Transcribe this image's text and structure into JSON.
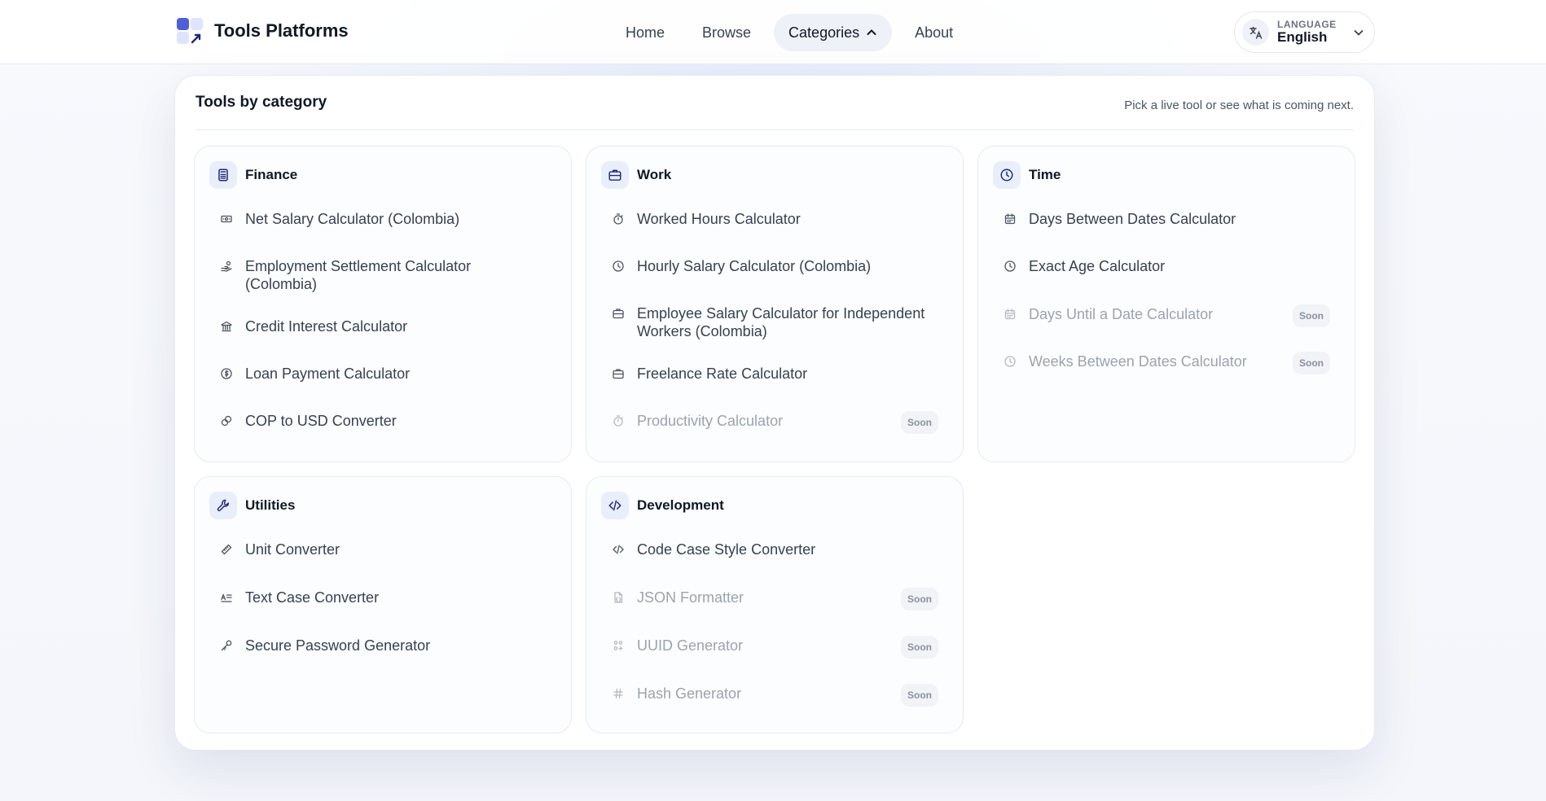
{
  "brand": {
    "name": "Tools Platforms"
  },
  "nav": {
    "home": "Home",
    "browse": "Browse",
    "categories": "Categories",
    "about": "About"
  },
  "language": {
    "caption": "LANGUAGE",
    "value": "English",
    "icon": "translate-icon"
  },
  "menu": {
    "title": "Tools by category",
    "hint": "Pick a live tool or see what is coming next.",
    "soon_label": "Soon",
    "categories": [
      {
        "name": "Finance",
        "icon": "calculator-icon",
        "tools": [
          {
            "label": "Net Salary Calculator (Colombia)",
            "icon": "banknote-icon",
            "status": "live"
          },
          {
            "label": "Employment Settlement Calculator (Colombia)",
            "icon": "hand-coins-icon",
            "status": "live"
          },
          {
            "label": "Credit Interest Calculator",
            "icon": "bank-icon",
            "status": "live"
          },
          {
            "label": "Loan Payment Calculator",
            "icon": "dollar-circle-icon",
            "status": "live"
          },
          {
            "label": "COP to USD Converter",
            "icon": "coins-icon",
            "status": "live"
          }
        ]
      },
      {
        "name": "Work",
        "icon": "briefcase-icon",
        "tools": [
          {
            "label": "Worked Hours Calculator",
            "icon": "stopwatch-icon",
            "status": "live"
          },
          {
            "label": "Hourly Salary Calculator (Colombia)",
            "icon": "clock-icon",
            "status": "live"
          },
          {
            "label": "Employee Salary Calculator for Independent Workers (Colombia)",
            "icon": "briefcase-icon",
            "status": "live"
          },
          {
            "label": "Freelance Rate Calculator",
            "icon": "briefcase-icon",
            "status": "live"
          },
          {
            "label": "Productivity Calculator",
            "icon": "stopwatch-icon",
            "status": "soon"
          }
        ]
      },
      {
        "name": "Time",
        "icon": "clock-icon",
        "tools": [
          {
            "label": "Days Between Dates Calculator",
            "icon": "calendar-icon",
            "status": "live"
          },
          {
            "label": "Exact Age Calculator",
            "icon": "clock-icon",
            "status": "live"
          },
          {
            "label": "Days Until a Date Calculator",
            "icon": "calendar-icon",
            "status": "soon"
          },
          {
            "label": "Weeks Between Dates Calculator",
            "icon": "clock-icon",
            "status": "soon"
          }
        ]
      },
      {
        "name": "Utilities",
        "icon": "wrench-icon",
        "tools": [
          {
            "label": "Unit Converter",
            "icon": "ruler-icon",
            "status": "live"
          },
          {
            "label": "Text Case Converter",
            "icon": "text-case-icon",
            "status": "live"
          },
          {
            "label": "Secure Password Generator",
            "icon": "key-icon",
            "status": "live"
          }
        ]
      },
      {
        "name": "Development",
        "icon": "code-icon",
        "tools": [
          {
            "label": "Code Case Style Converter",
            "icon": "code-icon",
            "status": "live"
          },
          {
            "label": "JSON Formatter",
            "icon": "file-json-icon",
            "status": "soon"
          },
          {
            "label": "UUID Generator",
            "icon": "fingerprint-icon",
            "status": "soon"
          },
          {
            "label": "Hash Generator",
            "icon": "hash-icon",
            "status": "soon"
          }
        ]
      }
    ]
  },
  "colors": {
    "accent": "#4f5fd8",
    "icon_bg": "#e9eefb",
    "muted_text": "#9ca3af"
  }
}
